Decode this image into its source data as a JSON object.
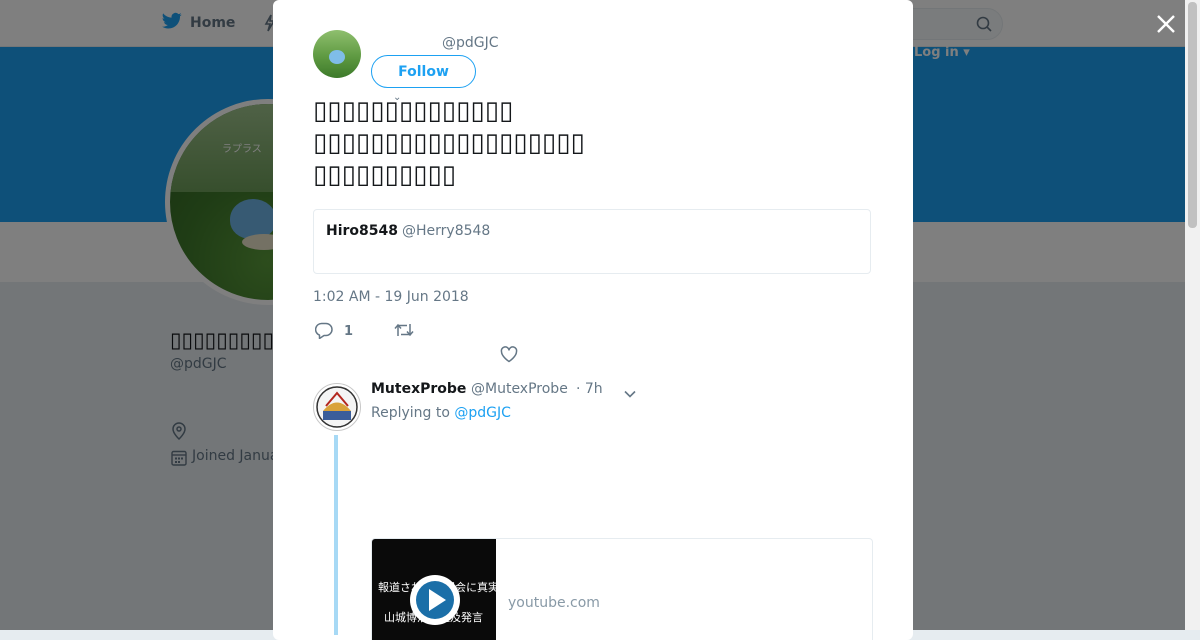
{
  "nav": {
    "home_label": "Home",
    "login_label": "Log in ▾"
  },
  "background_profile": {
    "display_name": "▯▯▯▯▯▯▯▯▯",
    "handle": "@pdGJC",
    "joined": "Joined Janua",
    "avatar_caption": "ラプラス"
  },
  "tweet": {
    "author_handle": "@pdGJC",
    "follow_label": "Follow",
    "text_lines": [
      "▯▯▯▯▯▯▯▯▯▯▯▯▯▯",
      "▯▯▯▯▯▯▯▯▯▯▯▯▯▯▯▯▯▯▯",
      "▯▯▯▯▯▯▯▯▯▯"
    ],
    "quote": {
      "name": "Hiro8548",
      "handle": "@Herry8548"
    },
    "timestamp": "1:02 AM - 19 Jun 2018",
    "reply_count": "1"
  },
  "reply": {
    "name": "MutexProbe",
    "handle": "@MutexProbe",
    "time": "· 7h",
    "replying_prefix": "Replying to",
    "replying_handle": "@pdGJC",
    "card": {
      "domain": "youtube.com",
      "thumb_line1": "報道されない国会に真実",
      "thumb_line2": "山城博治の追及発言"
    }
  },
  "colors": {
    "accent": "#1da1f2",
    "banner": "#1da1f2",
    "muted": "#657786",
    "thread_line": "#a7d9f5"
  },
  "icons": [
    "twitter-bird-icon",
    "moments-icon",
    "search-icon",
    "close-icon",
    "location-icon",
    "calendar-icon",
    "reply-icon",
    "retweet-icon",
    "heart-icon",
    "chevron-down-icon",
    "play-icon"
  ]
}
